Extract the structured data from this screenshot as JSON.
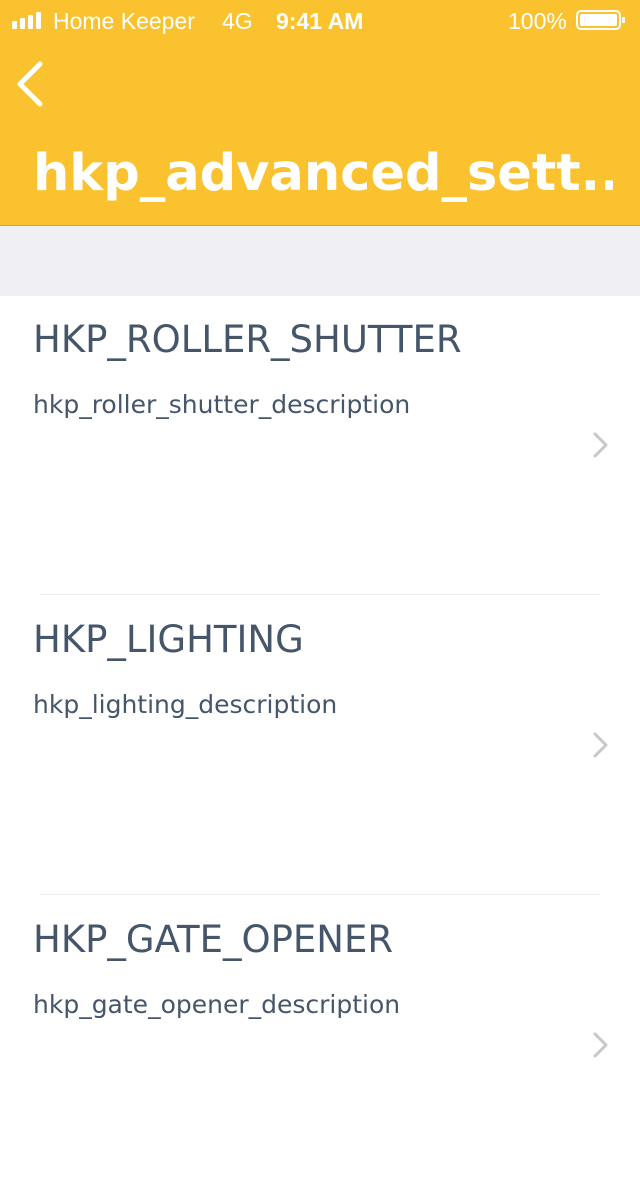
{
  "status_bar": {
    "carrier": "Home Keeper",
    "network": "4G",
    "time": "9:41 AM",
    "battery": "100%"
  },
  "header": {
    "title": "hkp_advanced_sett...",
    "back_icon": "chevron-left-icon"
  },
  "colors": {
    "header_bg": "#F9C22E",
    "spacer_bg": "#EFEFF4",
    "text": "#46566A",
    "chevron": "#C7C7CC"
  },
  "rows": [
    {
      "title": "HKP_ROLLER_SHUTTER",
      "description": "hkp_roller_shutter_description",
      "icon": "chevron-right-icon"
    },
    {
      "title": "HKP_LIGHTING",
      "description": "hkp_lighting_description",
      "icon": "chevron-right-icon"
    },
    {
      "title": "HKP_GATE_OPENER",
      "description": "hkp_gate_opener_description",
      "icon": "chevron-right-icon"
    }
  ]
}
